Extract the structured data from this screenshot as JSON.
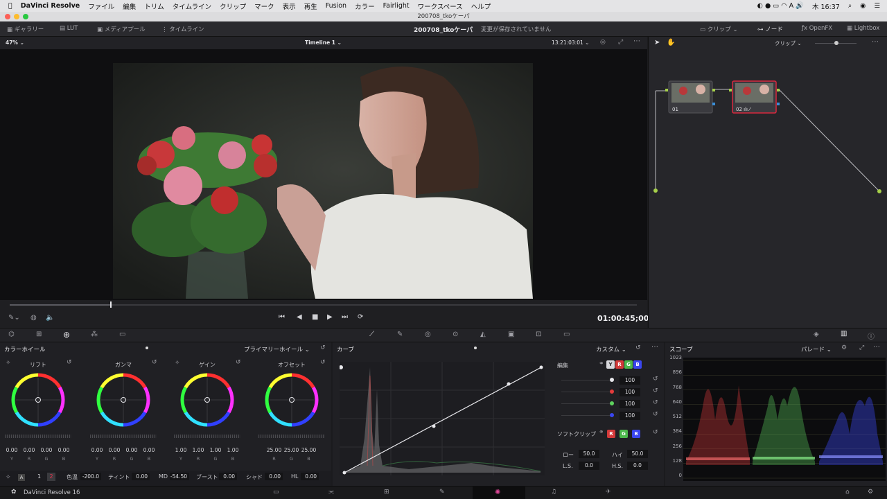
{
  "menubar": {
    "app": "DaVinci Resolve",
    "items": [
      "ファイル",
      "編集",
      "トリム",
      "タイムライン",
      "クリップ",
      "マーク",
      "表示",
      "再生",
      "Fusion",
      "カラー",
      "Fairlight",
      "ワークスペース",
      "ヘルプ"
    ],
    "clock": "木 16:37"
  },
  "window_title": "200708_tkoケーパ",
  "toolbar": {
    "gallery": "ギャラリー",
    "lut": "LUT",
    "media_pool": "メディアプール",
    "timeline": "タイムライン",
    "project": "200708_tkoケーパ",
    "status": "変更が保存されていません",
    "clip": "クリップ",
    "node": "ノード",
    "openfx": "OpenFX",
    "lightbox": "Lightbox"
  },
  "viewer": {
    "zoom": "47%",
    "timeline_name": "Timeline 1",
    "timecode": "13:21:03:01",
    "transport_timecode": "01:00:45;00",
    "scrub_fraction": 0.16
  },
  "nodes": {
    "mode": "クリップ",
    "items": [
      {
        "label": "01"
      },
      {
        "label": "02"
      }
    ]
  },
  "wheels": {
    "title": "カラーホイール",
    "mode": "プライマリーホイール",
    "wheels": [
      {
        "name": "リフト",
        "values": [
          "0.00",
          "0.00",
          "0.00",
          "0.00"
        ],
        "labels": [
          "Y",
          "R",
          "G",
          "B"
        ]
      },
      {
        "name": "ガンマ",
        "values": [
          "0.00",
          "0.00",
          "0.00",
          "0.00"
        ],
        "labels": [
          "Y",
          "R",
          "G",
          "B"
        ]
      },
      {
        "name": "ゲイン",
        "values": [
          "1.00",
          "1.00",
          "1.00",
          "1.00"
        ],
        "labels": [
          "Y",
          "R",
          "G",
          "B"
        ]
      },
      {
        "name": "オフセット",
        "values": [
          "25.00",
          "25.00",
          "25.00"
        ],
        "labels": [
          "R",
          "G",
          "B"
        ]
      }
    ],
    "bottom": {
      "page1": "1",
      "page2": "2",
      "hue_label": "色温",
      "hue_value": "-200.0",
      "tint_label": "ティント",
      "tint_value": "0.00",
      "md_label": "MD",
      "md_value": "-54.50",
      "boost_label": "ブースト",
      "boost_value": "0.00",
      "shadow_label": "シャド",
      "shadow_value": "0.00",
      "hl_label": "HL",
      "hl_value": "0.00"
    }
  },
  "curves": {
    "title": "カーブ",
    "mode": "カスタム",
    "edit_label": "編集",
    "channels": [
      "Y",
      "R",
      "G",
      "B"
    ],
    "intensities": [
      "100",
      "100",
      "100",
      "100"
    ],
    "softclip_label": "ソフトクリップ",
    "softclip_channels": [
      "R",
      "G",
      "B"
    ],
    "low_label": "ロー",
    "low_value": "50.0",
    "high_label": "ハイ",
    "high_value": "50.0",
    "ls_label": "L.S.",
    "ls_value": "0.0",
    "hs_label": "H.S.",
    "hs_value": "0.0"
  },
  "scopes": {
    "title": "スコープ",
    "mode": "パレード",
    "axis": [
      "1023",
      "896",
      "768",
      "640",
      "512",
      "384",
      "256",
      "128",
      "0"
    ]
  },
  "bottombar": {
    "app": "DaVinci Resolve 16"
  },
  "colors": {
    "accent": "#e2334a",
    "red": "#e43c3c",
    "green": "#5ed35e",
    "blue": "#3a46f0"
  }
}
